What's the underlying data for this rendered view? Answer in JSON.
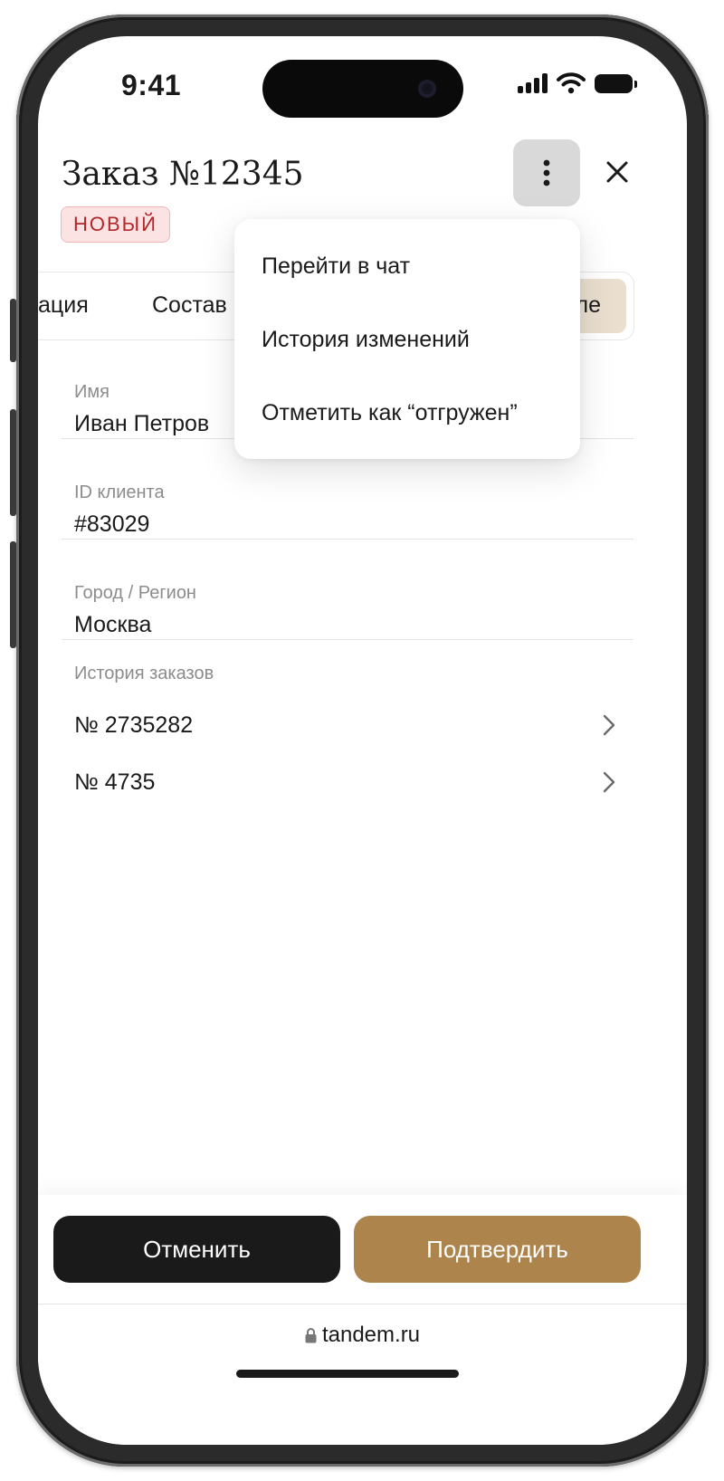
{
  "status_bar": {
    "time": "9:41"
  },
  "header": {
    "title": "Заказ №12345",
    "status_badge": "НОВЫЙ"
  },
  "tabs": [
    {
      "label": "ация"
    },
    {
      "label": "Состав"
    },
    {
      "label": "ле",
      "active": true
    }
  ],
  "customer": {
    "fields": [
      {
        "label": "Имя",
        "value": "Иван Петров"
      },
      {
        "label": "ID клиента",
        "value": "#83029"
      },
      {
        "label": "Город / Регион",
        "value": "Москва"
      }
    ],
    "order_history": {
      "label": "История заказов",
      "orders": [
        "№ 2735282",
        "№ 4735"
      ]
    }
  },
  "menu": {
    "items": [
      "Перейти в чат",
      "История изменений",
      "Отметить как “отгружен”"
    ]
  },
  "actions": {
    "cancel_label": "Отменить",
    "confirm_label": "Подтвердить"
  },
  "browser": {
    "url": "tandem.ru"
  },
  "colors": {
    "accent": "#ad844c",
    "dark_button": "#1a1a1a",
    "badge_text": "#b3262a",
    "badge_bg": "#fbe3e3",
    "active_tab_bg": "#eadfcf"
  },
  "icons": [
    "cellular-signal-icon",
    "wifi-icon",
    "battery-icon",
    "more-vertical-icon",
    "close-icon",
    "chevron-right-icon",
    "lock-icon"
  ]
}
